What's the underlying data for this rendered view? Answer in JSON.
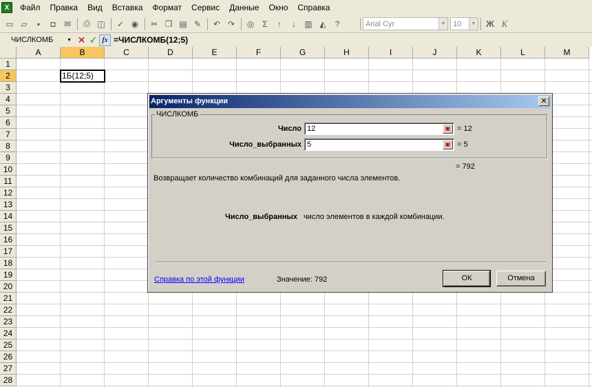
{
  "menu": {
    "items": [
      "Файл",
      "Правка",
      "Вид",
      "Вставка",
      "Формат",
      "Сервис",
      "Данные",
      "Окно",
      "Справка"
    ]
  },
  "toolbar": {
    "font_name": "Arial Cyr",
    "font_size": "10",
    "bold_label": "Ж",
    "italic_label": "К"
  },
  "formula_bar": {
    "name_box": "ЧИСЛКОМБ",
    "fx_label": "fx",
    "formula": "=ЧИСЛКОМБ(12;5)"
  },
  "grid": {
    "columns": [
      "A",
      "B",
      "C",
      "D",
      "E",
      "F",
      "G",
      "H",
      "I",
      "J",
      "K",
      "L",
      "M"
    ],
    "rows": [
      "1",
      "2",
      "3",
      "4",
      "5",
      "6",
      "7",
      "8",
      "9",
      "10",
      "11",
      "12",
      "13",
      "14",
      "15",
      "16",
      "17",
      "18",
      "19",
      "20",
      "21",
      "22",
      "23",
      "24",
      "25",
      "26",
      "27",
      "28"
    ],
    "active_cell_text": "1Б(12;5)"
  },
  "dialog": {
    "title": "Аргументы функции",
    "close": "✕",
    "function_name": "ЧИСЛКОМБ",
    "args": [
      {
        "label": "Число",
        "value": "12",
        "result": "= 12"
      },
      {
        "label": "Число_выбранных",
        "value": "5",
        "result": "= 5"
      }
    ],
    "function_result": "= 792",
    "description": "Возвращает количество комбинаций для заданного числа элементов.",
    "arg_help_name": "Число_выбранных",
    "arg_help_text": "число элементов в каждой комбинации.",
    "help_link": "Справка по этой функции",
    "value_label": "Значение:  792",
    "ok_label": "ОК",
    "cancel_label": "Отмена"
  }
}
